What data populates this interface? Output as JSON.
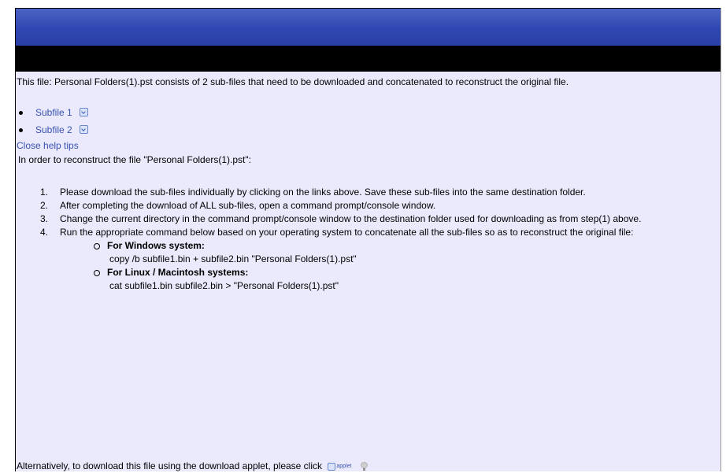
{
  "intro": "This file: Personal Folders(1).pst consists of 2 sub-files that need to be downloaded and concatenated to reconstruct the original file.",
  "subfiles": [
    {
      "label": "Subfile 1",
      "icon": "download-icon"
    },
    {
      "label": "Subfile 2",
      "icon": "download-icon"
    }
  ],
  "close_help": "Close help tips",
  "lead": "In order to reconstruct the file \"Personal Folders(1).pst\":",
  "steps": [
    {
      "num": "1.",
      "text": "Please download the sub-files individually by clicking on the links above. Save these sub-files into the same destination folder."
    },
    {
      "num": "2.",
      "text": "After completing the download of ALL sub-files, open a command prompt/console window."
    },
    {
      "num": "3.",
      "text": "Change the current directory in the command prompt/console window to the destination folder used for downloading as from step(1) above."
    },
    {
      "num": "4.",
      "text": "Run the appropriate command below based on your operating system to concatenate all the sub-files so as to reconstruct the original file:"
    }
  ],
  "os_commands": [
    {
      "os": "For Windows system:",
      "command": "copy /b subfile1.bin + subfile2.bin \"Personal Folders(1).pst\""
    },
    {
      "os": "For Linux / Macintosh systems:",
      "command": "cat subfile1.bin subfile2.bin > \"Personal Folders(1).pst\""
    }
  ],
  "alternative": "Alternatively, to download this file using the download applet, please click",
  "applet_label": "applet",
  "colors": {
    "header_blue": "#3047b2",
    "background": "#eaeafc",
    "link": "#3a52b0"
  }
}
